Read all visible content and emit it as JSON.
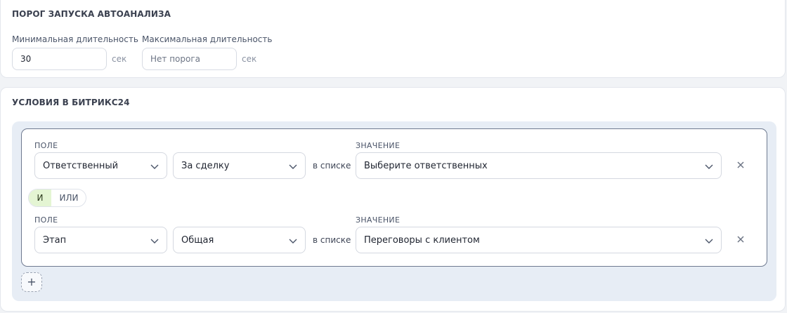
{
  "threshold": {
    "title": "ПОРОГ ЗАПУСКА АВТОАНАЛИЗА",
    "min": {
      "label": "Минимальная длительность",
      "value": "30",
      "unit": "сек"
    },
    "max": {
      "label": "Максимальная длительность",
      "value": "",
      "placeholder": "Нет порога",
      "unit": "сек"
    }
  },
  "conditions": {
    "title": "УСЛОВИЯ В БИТРИКС24",
    "rows": [
      {
        "field_label": "ПОЛЕ",
        "field": "Ответственный",
        "mode": "За сделку",
        "operator": "в списке",
        "value_label": "ЗНАЧЕНИЕ",
        "value": "Выберите ответственных"
      },
      {
        "field_label": "ПОЛЕ",
        "field": "Этап",
        "mode": "Общая",
        "operator": "в списке",
        "value_label": "ЗНАЧЕНИЕ",
        "value": "Переговоры с клиентом"
      }
    ],
    "logic": {
      "and": "И",
      "or": "ИЛИ",
      "selected": "and"
    },
    "add_label": "+"
  },
  "icons": {
    "chevron": "chevron-down-icon",
    "remove": "close-icon",
    "add": "plus-icon"
  },
  "colors": {
    "accent_selected": "#e4f5d3",
    "rules_background": "#e7edf5",
    "group_border": "#6f7a90"
  }
}
